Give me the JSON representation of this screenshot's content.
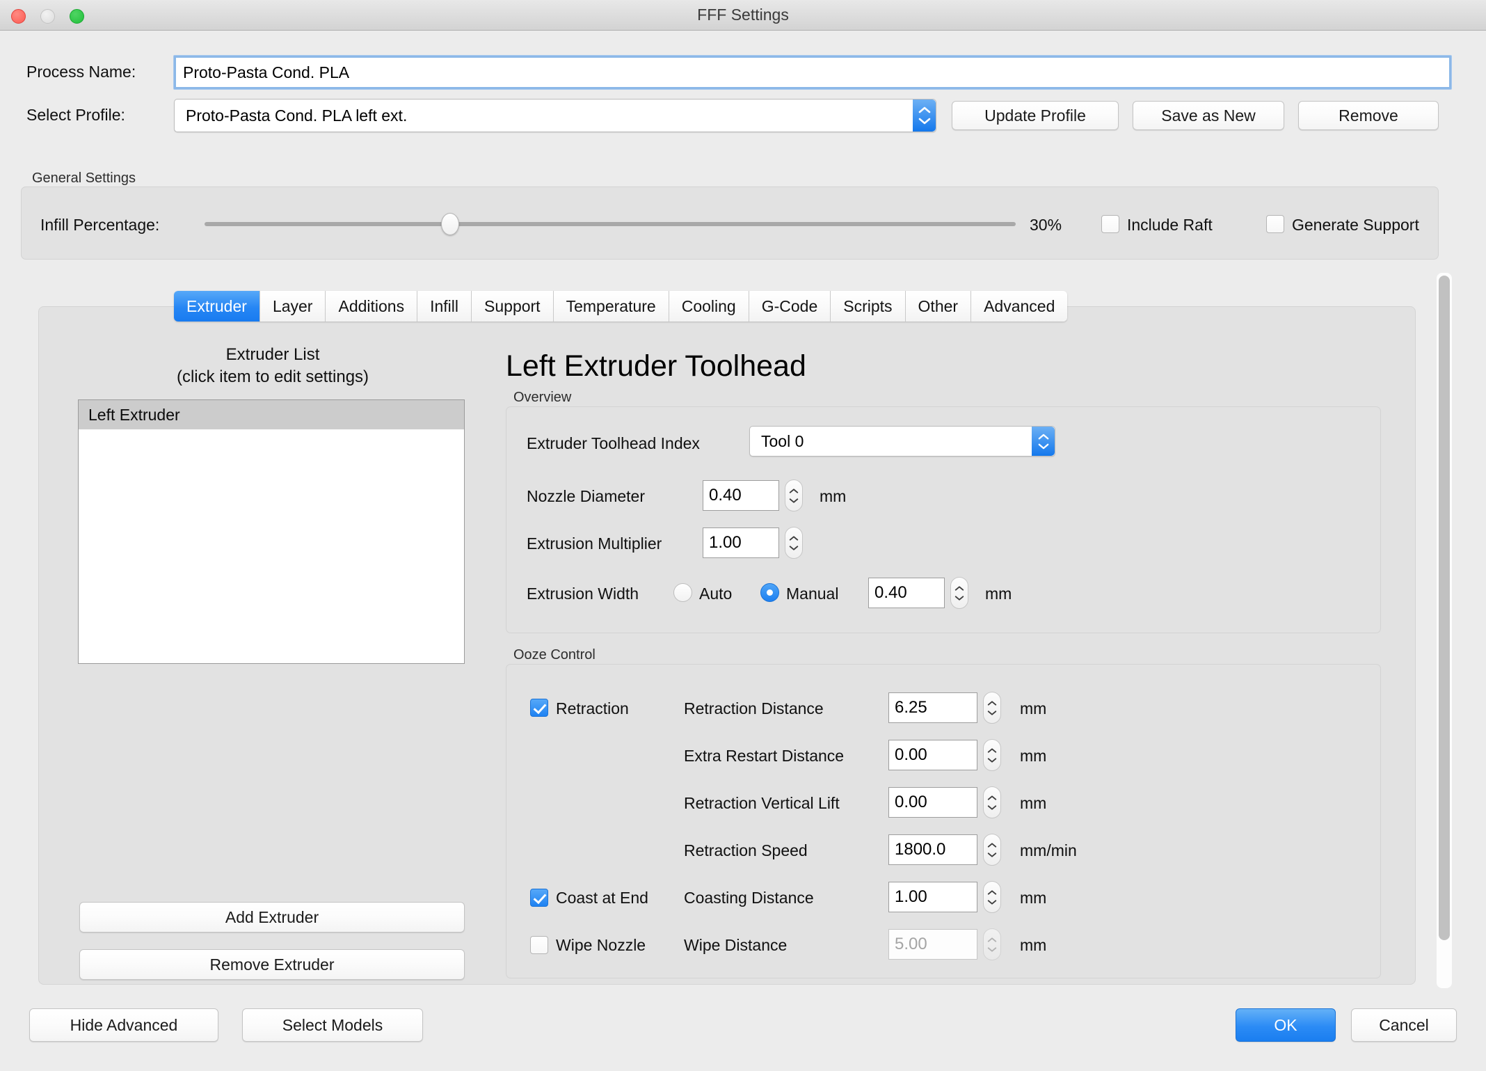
{
  "window": {
    "title": "FFF Settings",
    "traffic_lights": [
      "close",
      "minimize",
      "zoom"
    ]
  },
  "form": {
    "process_name_label": "Process Name:",
    "process_name_value": "Proto-Pasta Cond. PLA",
    "select_profile_label": "Select Profile:",
    "select_profile_value": "Proto-Pasta Cond. PLA left ext.",
    "update_profile_label": "Update Profile",
    "save_as_new_label": "Save as New",
    "remove_label": "Remove"
  },
  "general_settings": {
    "group_title": "General Settings",
    "infill_label": "Infill Percentage:",
    "infill_value_text": "30%",
    "infill_percent": 30,
    "include_raft_label": "Include Raft",
    "include_raft_checked": false,
    "generate_support_label": "Generate Support",
    "generate_support_checked": false
  },
  "tabs": {
    "active": "Extruder",
    "items": [
      {
        "label": "Extruder"
      },
      {
        "label": "Layer"
      },
      {
        "label": "Additions"
      },
      {
        "label": "Infill"
      },
      {
        "label": "Support"
      },
      {
        "label": "Temperature"
      },
      {
        "label": "Cooling"
      },
      {
        "label": "G-Code"
      },
      {
        "label": "Scripts"
      },
      {
        "label": "Other"
      },
      {
        "label": "Advanced"
      }
    ]
  },
  "extruder_list": {
    "heading_line1": "Extruder List",
    "heading_line2": "(click item to edit settings)",
    "items": [
      {
        "label": "Left Extruder",
        "selected": true
      }
    ],
    "add_label": "Add Extruder",
    "remove_label": "Remove Extruder"
  },
  "toolhead": {
    "title": "Left Extruder Toolhead",
    "overview_group": "Overview",
    "index_label": "Extruder Toolhead Index",
    "index_value": "Tool 0",
    "nozzle_label": "Nozzle Diameter",
    "nozzle_value": "0.40",
    "nozzle_unit": "mm",
    "multiplier_label": "Extrusion Multiplier",
    "multiplier_value": "1.00",
    "multiplier_unit": "",
    "width_label": "Extrusion Width",
    "width_auto_label": "Auto",
    "width_manual_label": "Manual",
    "width_mode": "Manual",
    "width_value": "0.40",
    "width_unit": "mm"
  },
  "ooze_control": {
    "group_title": "Ooze Control",
    "retraction_label": "Retraction",
    "retraction_checked": true,
    "coast_label": "Coast at End",
    "coast_checked": true,
    "wipe_label": "Wipe Nozzle",
    "wipe_checked": false,
    "rows": [
      {
        "label": "Retraction Distance",
        "value": "6.25",
        "unit": "mm",
        "disabled": false
      },
      {
        "label": "Extra Restart Distance",
        "value": "0.00",
        "unit": "mm",
        "disabled": false
      },
      {
        "label": "Retraction Vertical Lift",
        "value": "0.00",
        "unit": "mm",
        "disabled": false
      },
      {
        "label": "Retraction Speed",
        "value": "1800.0",
        "unit": "mm/min",
        "disabled": false
      },
      {
        "label": "Coasting Distance",
        "value": "1.00",
        "unit": "mm",
        "disabled": false
      },
      {
        "label": "Wipe Distance",
        "value": "5.00",
        "unit": "mm",
        "disabled": true
      }
    ]
  },
  "footer": {
    "hide_advanced_label": "Hide Advanced",
    "select_models_label": "Select Models",
    "ok_label": "OK",
    "cancel_label": "Cancel"
  },
  "colors": {
    "accent_blue": "#1e82f2",
    "window_bg": "#ececec",
    "panel_bg": "#e2e2e2",
    "selected_row": "#cccccc"
  }
}
